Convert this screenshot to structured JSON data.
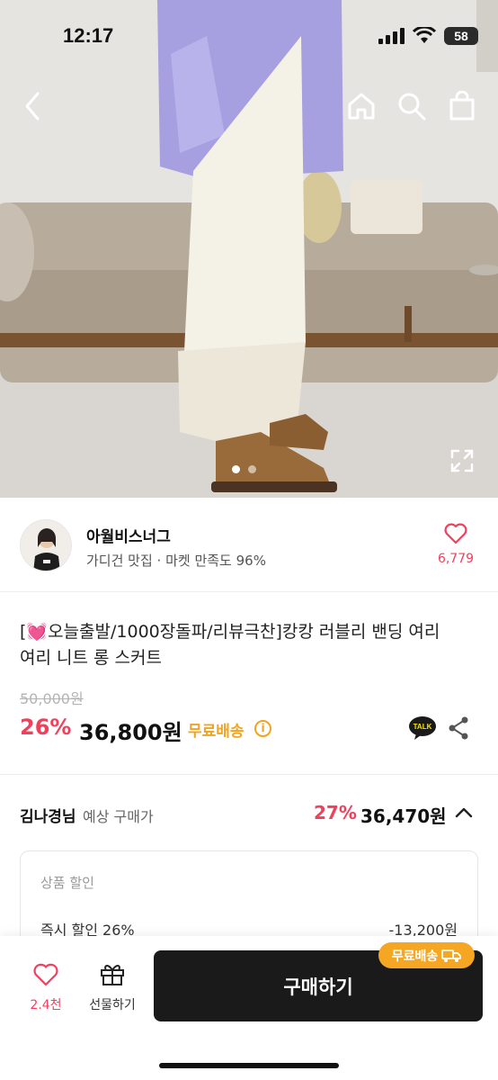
{
  "status_bar": {
    "time": "12:17",
    "battery": "58"
  },
  "seller": {
    "name": "아월비스너그",
    "subtitle": "가디건 맛집 · 마켓 만족도 96%",
    "like_count": "6,779"
  },
  "product": {
    "title_line1": "[💓오늘출발/1000장돌파/리뷰극찬]캉캉 러블리 밴딩 여리",
    "title_line2": "여리 니트 롱 스커트",
    "original_price": "50,000원",
    "discount": "26%",
    "price": "36,800원",
    "free_shipping": "무료배송",
    "talk_label": "TALK"
  },
  "expected": {
    "name": "김나경님",
    "label": "예상 구매가",
    "discount": "27%",
    "price": "36,470원",
    "section_title": "상품 할인",
    "row_label": "즉시 할인 26%",
    "row_value": "-13,200원"
  },
  "bottom_bar": {
    "like_label": "2.4천",
    "gift_label": "선물하기",
    "buy_label": "구매하기",
    "badge_label": "무료배송"
  },
  "colors": {
    "accent_red": "#f2405c",
    "shipping_orange": "#f0a422",
    "buy_button": "#1a1a1a"
  }
}
